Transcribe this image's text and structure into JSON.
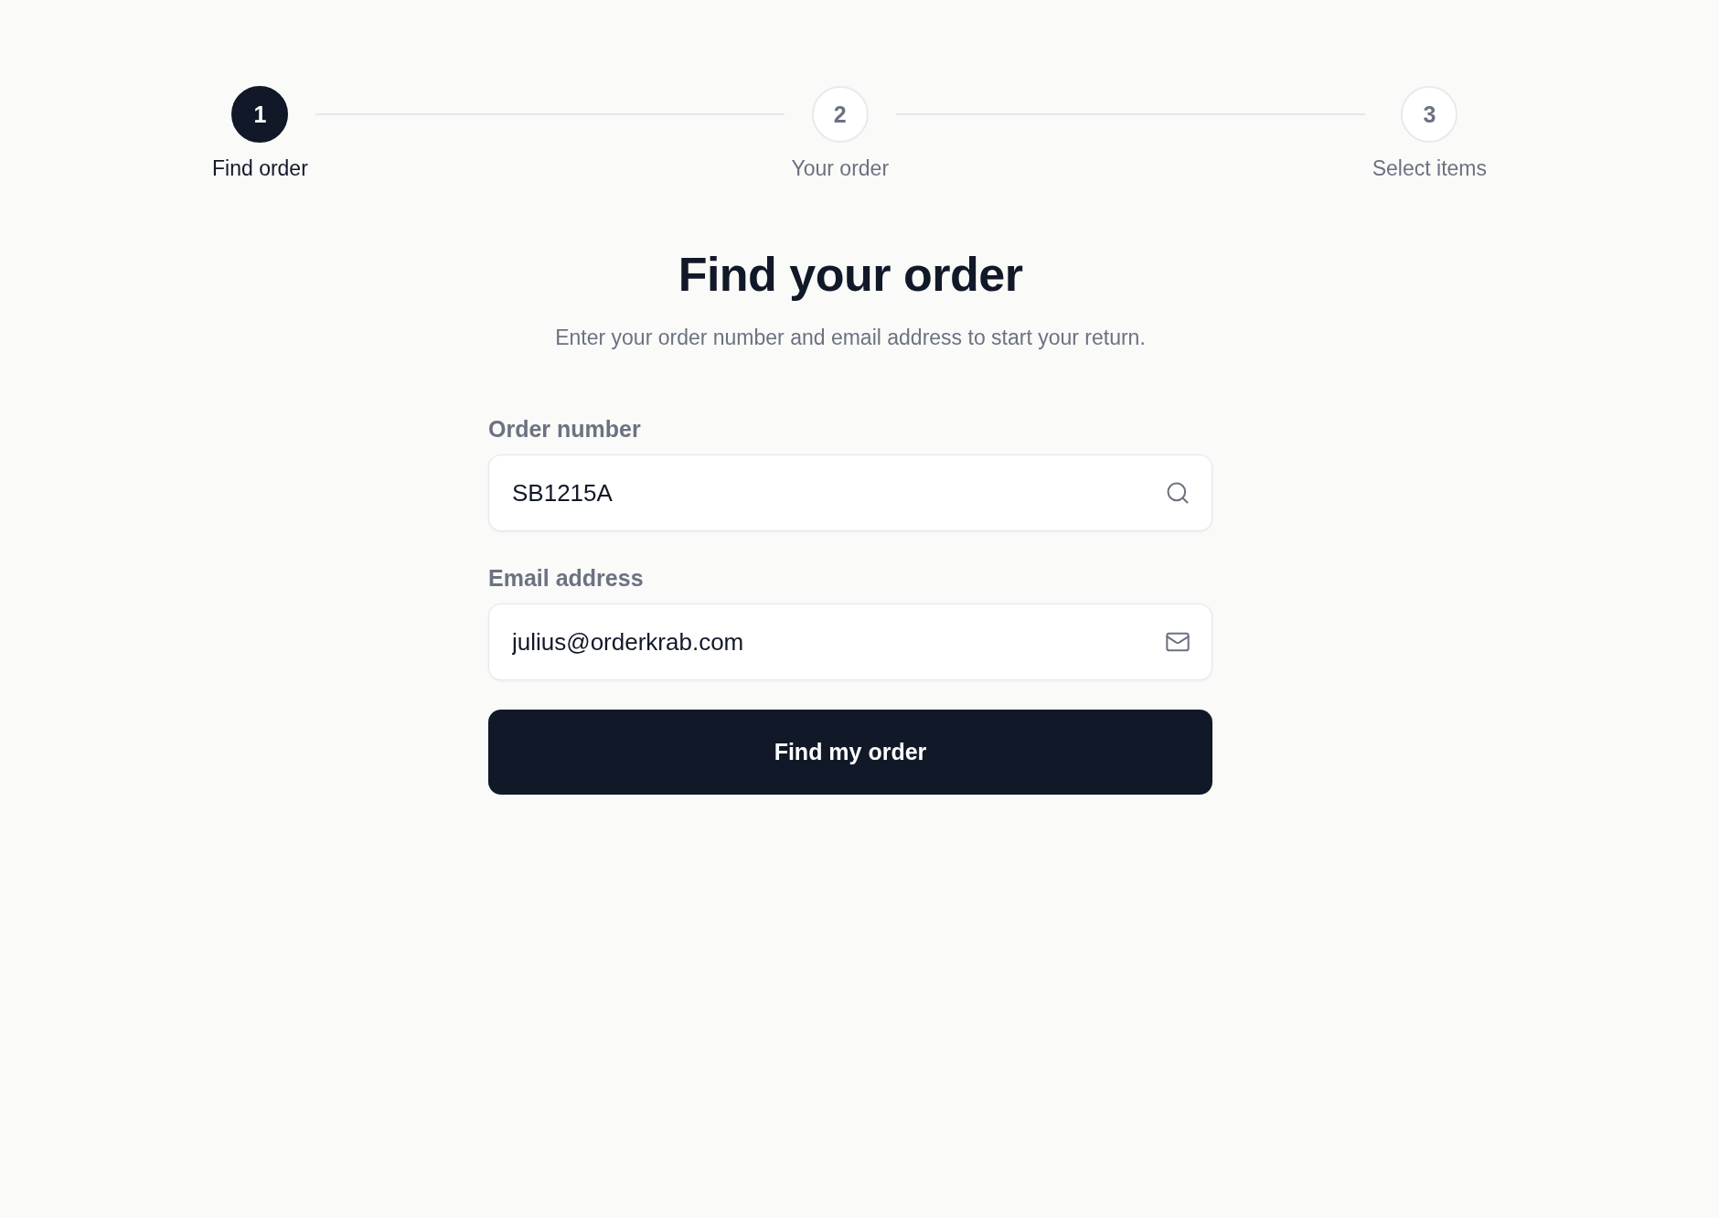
{
  "steps": [
    {
      "number": "1",
      "label": "Find order",
      "selected": true
    },
    {
      "number": "2",
      "label": "Your order",
      "selected": false
    },
    {
      "number": "3",
      "label": "Select items",
      "selected": false
    }
  ],
  "heading": "Find your order",
  "subheading": "Enter your order number and email address to start your return.",
  "fields": [
    {
      "kind": "search",
      "label": "Order number",
      "value": "SB1215A"
    },
    {
      "kind": "email",
      "label": "Email address",
      "value": "julius@orderkrab.com"
    }
  ],
  "submit_button": {
    "label": "Find my order"
  }
}
